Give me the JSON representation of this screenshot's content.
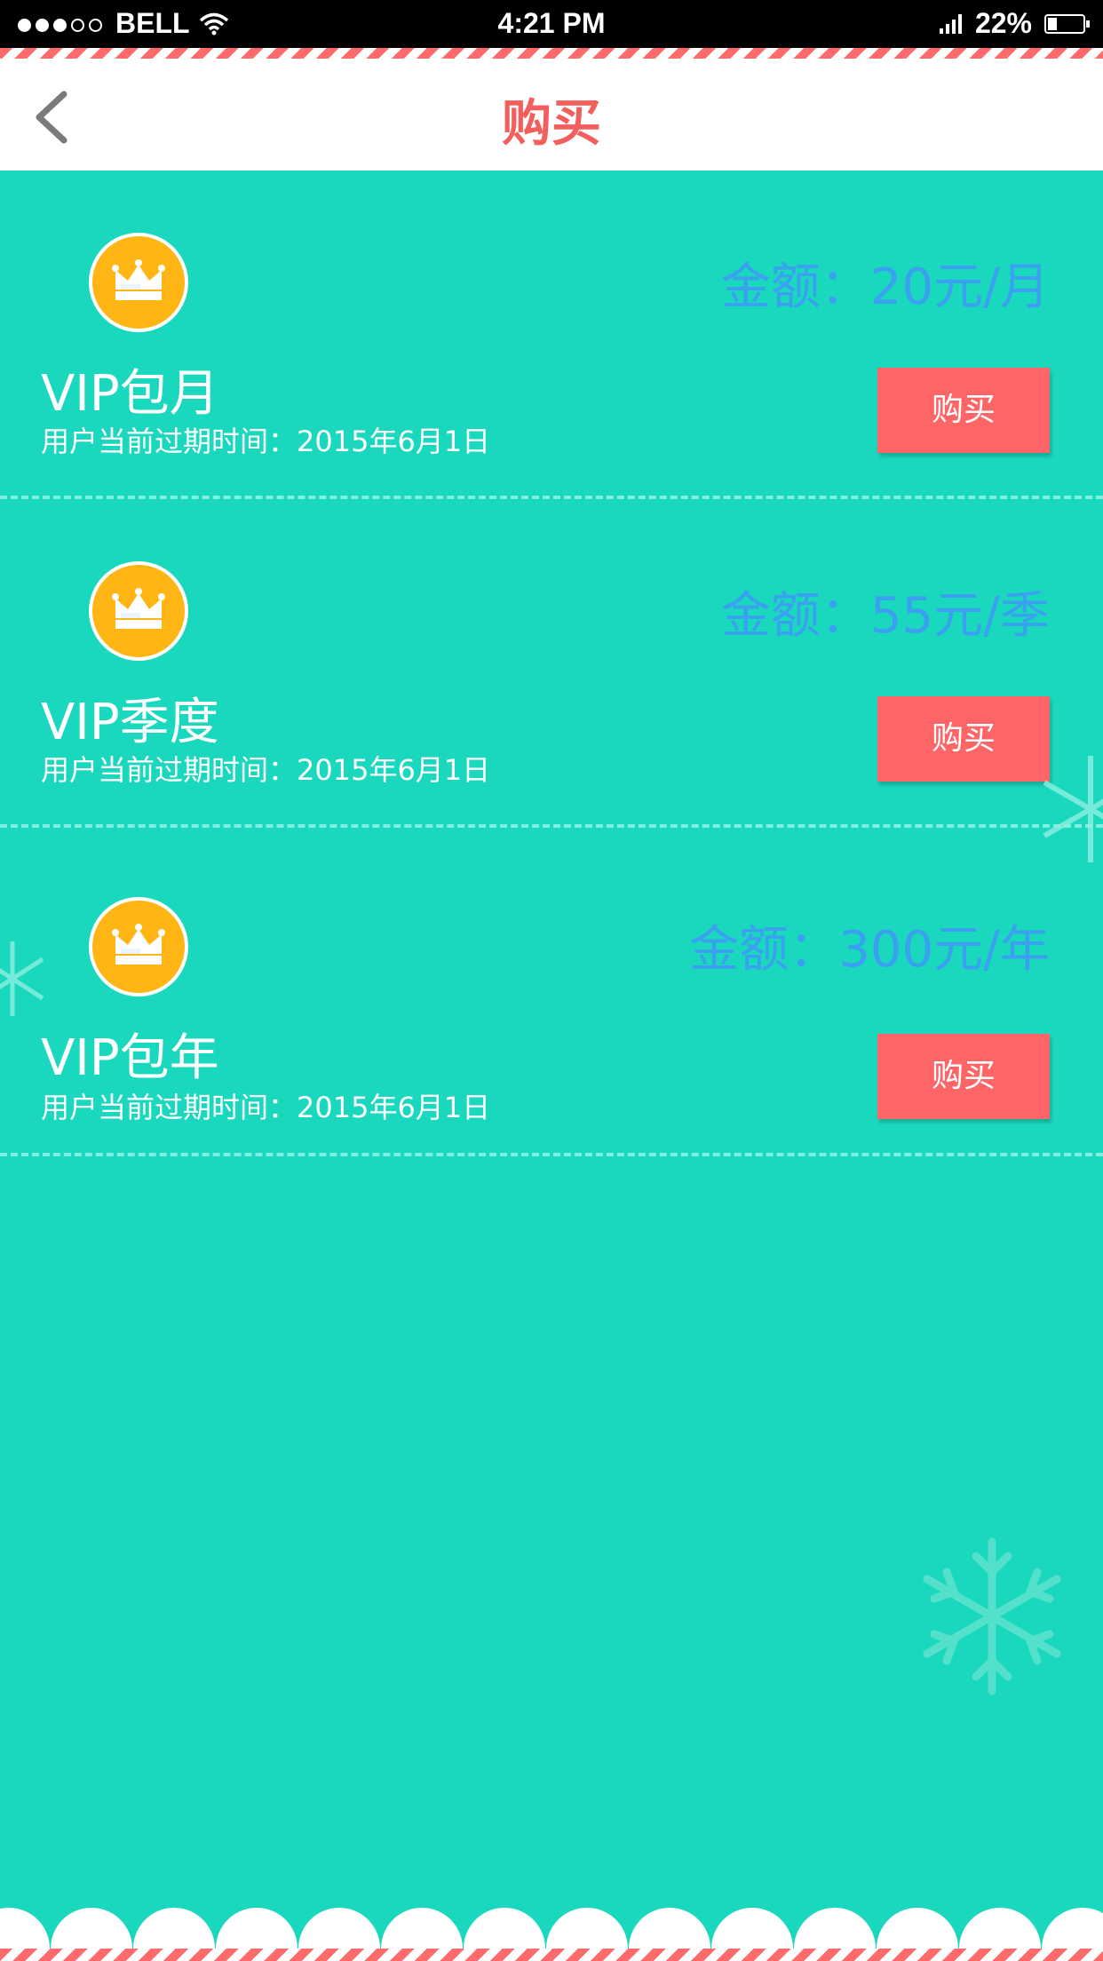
{
  "status_bar": {
    "carrier": "BELL",
    "time": "4:21  PM",
    "battery": "22%"
  },
  "nav": {
    "title": "购买"
  },
  "plans": [
    {
      "title": "VIP包月",
      "expiry": "用户当前过期时间：2015年6月1日",
      "price": "金额：20元/月",
      "buy_label": "购买"
    },
    {
      "title": "VIP季度",
      "expiry": "用户当前过期时间：2015年6月1日",
      "price": "金额：55元/季",
      "buy_label": "购买"
    },
    {
      "title": "VIP包年",
      "expiry": "用户当前过期时间：2015年6月1日",
      "price": "金额：300元/年",
      "buy_label": "购买"
    }
  ],
  "colors": {
    "background": "#1ad8be",
    "title_red": "#f25f5c",
    "price_blue": "#3aa0f0",
    "button_red": "#fd6566",
    "crown_gold": "#ffb614"
  },
  "icons": [
    "signal-dots-icon",
    "wifi-icon",
    "cell-signal-icon",
    "battery-icon",
    "back-arrow-icon",
    "crown-icon",
    "snowflake-icon"
  ]
}
